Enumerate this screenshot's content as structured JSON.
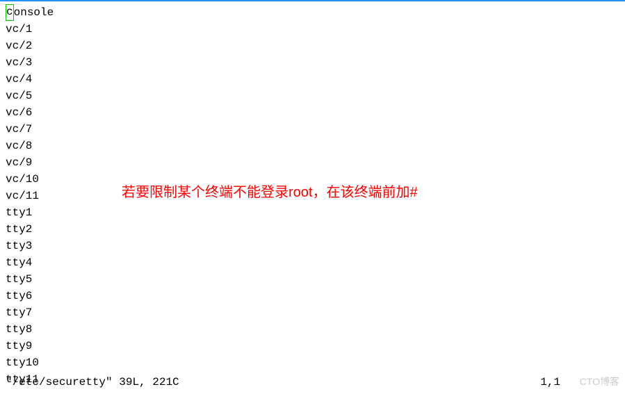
{
  "lines": [
    "console",
    "vc/1",
    "vc/2",
    "vc/3",
    "vc/4",
    "vc/5",
    "vc/6",
    "vc/7",
    "vc/8",
    "vc/9",
    "vc/10",
    "vc/11",
    "tty1",
    "tty2",
    "tty3",
    "tty4",
    "tty5",
    "tty6",
    "tty7",
    "tty8",
    "tty9",
    "tty10",
    "tty11"
  ],
  "first_line_cursor": "c",
  "first_line_rest": "onsole",
  "annotation": "若要限制某个终端不能登录root，在该终端前加#",
  "status": {
    "file_info": "\"/etc/securetty\" 39L, 221C",
    "position": "1,1"
  },
  "watermark": "CTO博客"
}
